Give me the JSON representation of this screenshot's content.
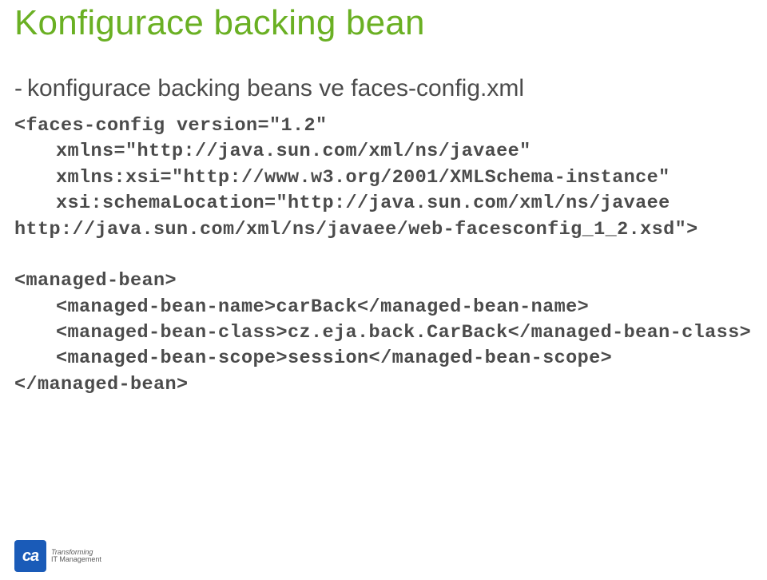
{
  "title": "Konfigurace backing bean",
  "bullet": "konfigurace backing beans ve faces-config.xml",
  "code": {
    "l1": "<faces-config version=\"1.2\"",
    "l2": "xmlns=\"http://java.sun.com/xml/ns/javaee\"",
    "l3": "xmlns:xsi=\"http://www.w3.org/2001/XMLSchema-instance\"",
    "l4": "xsi:schemaLocation=\"http://java.sun.com/xml/ns/javaee",
    "l5": "http://java.sun.com/xml/ns/javaee/web-facesconfig_1_2.xsd\">",
    "l6": "<managed-bean>",
    "l7": "<managed-bean-name>carBack</managed-bean-name>",
    "l8": "<managed-bean-class>cz.eja.back.CarBack</managed-bean-class>",
    "l9": "<managed-bean-scope>session</managed-bean-scope>",
    "l10": "</managed-bean>"
  },
  "logo": {
    "ca": "ca",
    "tag1": "Transforming",
    "tag2": "IT Management"
  }
}
